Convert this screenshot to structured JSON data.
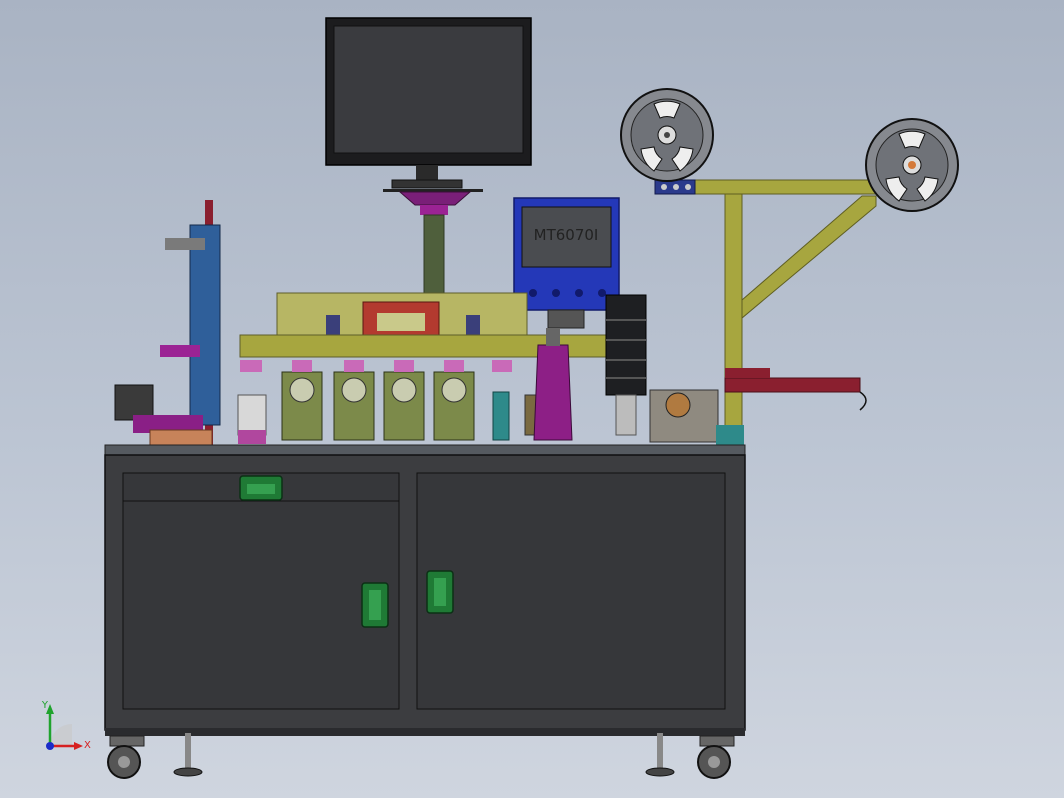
{
  "hmi": {
    "model_label": "MT6070I"
  },
  "triad": {
    "x_label": "X",
    "y_label": "Y"
  },
  "colors": {
    "background_top": "#a9b3c3",
    "cabinet": "#3c3d40",
    "frame_yellow": "#a7a63f",
    "hmi_blue": "#2438b8",
    "accent_magenta": "#8d1f86",
    "handle_green": "#1f7a35",
    "axis_x": "#d62020",
    "axis_y": "#1fa32d",
    "axis_origin": "#1a2cc8"
  },
  "components": [
    "monitor",
    "monitor-stand",
    "hmi-panel",
    "reel-left",
    "reel-right",
    "reel-frame",
    "machine-table",
    "cabinet",
    "cabinet-drawer",
    "cabinet-door-left",
    "cabinet-door-right",
    "caster-left",
    "caster-right",
    "leveling-foot-left",
    "leveling-foot-right",
    "coordinate-triad"
  ]
}
